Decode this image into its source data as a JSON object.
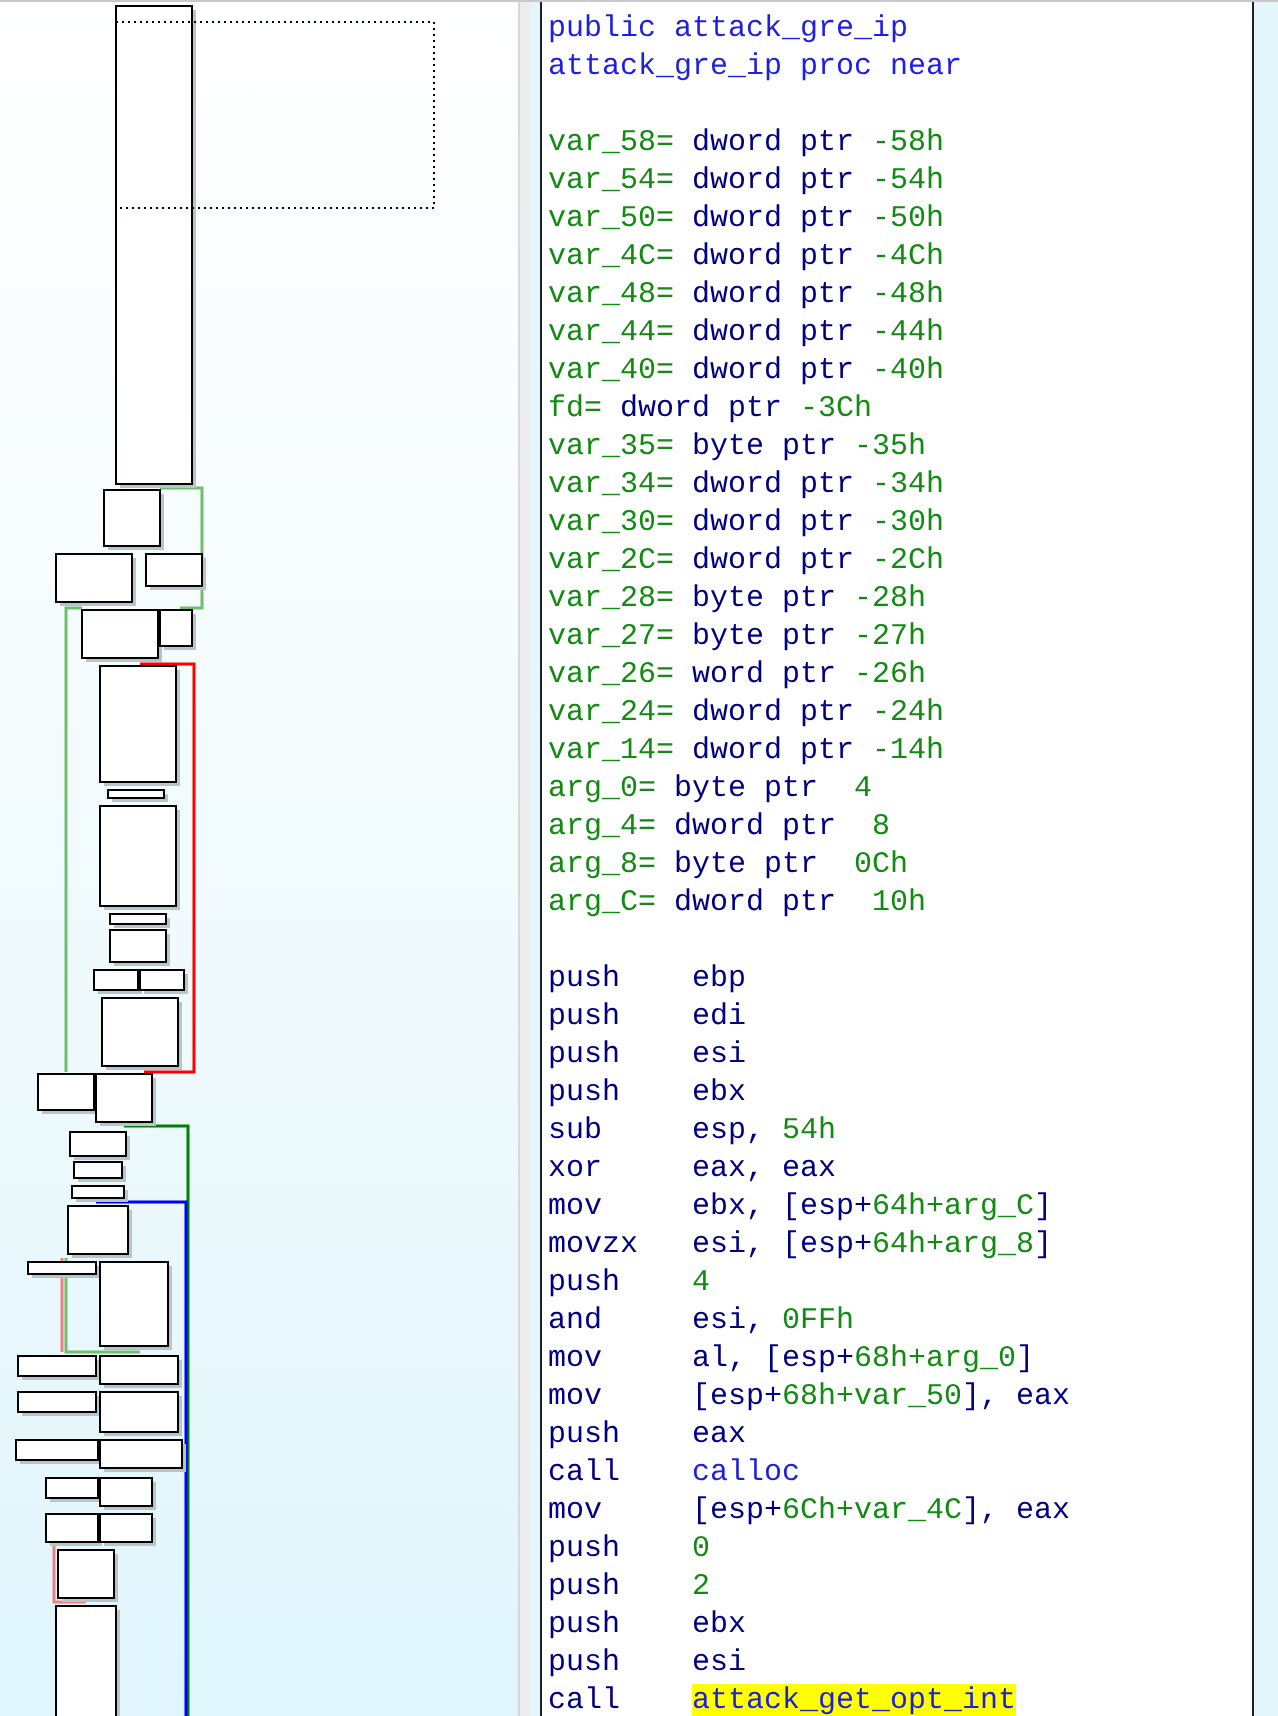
{
  "listing": [
    {
      "kind": "text",
      "tokens": [
        {
          "text": "public attack_gre_ip",
          "kind": "label"
        }
      ]
    },
    {
      "kind": "text",
      "tokens": [
        {
          "text": "attack_gre_ip proc near",
          "kind": "label"
        }
      ]
    },
    {
      "kind": "blank"
    },
    {
      "kind": "text",
      "tokens": [
        {
          "text": "var_58=",
          "kind": "value"
        },
        {
          "text": " dword ptr ",
          "kind": "keyword"
        },
        {
          "text": "-58h",
          "kind": "value"
        }
      ]
    },
    {
      "kind": "text",
      "tokens": [
        {
          "text": "var_54=",
          "kind": "value"
        },
        {
          "text": " dword ptr ",
          "kind": "keyword"
        },
        {
          "text": "-54h",
          "kind": "value"
        }
      ]
    },
    {
      "kind": "text",
      "tokens": [
        {
          "text": "var_50=",
          "kind": "value"
        },
        {
          "text": " dword ptr ",
          "kind": "keyword"
        },
        {
          "text": "-50h",
          "kind": "value"
        }
      ]
    },
    {
      "kind": "text",
      "tokens": [
        {
          "text": "var_4C=",
          "kind": "value"
        },
        {
          "text": " dword ptr ",
          "kind": "keyword"
        },
        {
          "text": "-4Ch",
          "kind": "value"
        }
      ]
    },
    {
      "kind": "text",
      "tokens": [
        {
          "text": "var_48=",
          "kind": "value"
        },
        {
          "text": " dword ptr ",
          "kind": "keyword"
        },
        {
          "text": "-48h",
          "kind": "value"
        }
      ]
    },
    {
      "kind": "text",
      "tokens": [
        {
          "text": "var_44=",
          "kind": "value"
        },
        {
          "text": " dword ptr ",
          "kind": "keyword"
        },
        {
          "text": "-44h",
          "kind": "value"
        }
      ]
    },
    {
      "kind": "text",
      "tokens": [
        {
          "text": "var_40=",
          "kind": "value"
        },
        {
          "text": " dword ptr ",
          "kind": "keyword"
        },
        {
          "text": "-40h",
          "kind": "value"
        }
      ]
    },
    {
      "kind": "text",
      "tokens": [
        {
          "text": "fd=",
          "kind": "value"
        },
        {
          "text": " dword ptr ",
          "kind": "keyword"
        },
        {
          "text": "-3Ch",
          "kind": "value"
        }
      ]
    },
    {
      "kind": "text",
      "tokens": [
        {
          "text": "var_35=",
          "kind": "value"
        },
        {
          "text": " byte ptr ",
          "kind": "keyword"
        },
        {
          "text": "-35h",
          "kind": "value"
        }
      ]
    },
    {
      "kind": "text",
      "tokens": [
        {
          "text": "var_34=",
          "kind": "value"
        },
        {
          "text": " dword ptr ",
          "kind": "keyword"
        },
        {
          "text": "-34h",
          "kind": "value"
        }
      ]
    },
    {
      "kind": "text",
      "tokens": [
        {
          "text": "var_30=",
          "kind": "value"
        },
        {
          "text": " dword ptr ",
          "kind": "keyword"
        },
        {
          "text": "-30h",
          "kind": "value"
        }
      ]
    },
    {
      "kind": "text",
      "tokens": [
        {
          "text": "var_2C=",
          "kind": "value"
        },
        {
          "text": " dword ptr ",
          "kind": "keyword"
        },
        {
          "text": "-2Ch",
          "kind": "value"
        }
      ]
    },
    {
      "kind": "text",
      "tokens": [
        {
          "text": "var_28=",
          "kind": "value"
        },
        {
          "text": " byte ptr ",
          "kind": "keyword"
        },
        {
          "text": "-28h",
          "kind": "value"
        }
      ]
    },
    {
      "kind": "text",
      "tokens": [
        {
          "text": "var_27=",
          "kind": "value"
        },
        {
          "text": " byte ptr ",
          "kind": "keyword"
        },
        {
          "text": "-27h",
          "kind": "value"
        }
      ]
    },
    {
      "kind": "text",
      "tokens": [
        {
          "text": "var_26=",
          "kind": "value"
        },
        {
          "text": " word ptr ",
          "kind": "keyword"
        },
        {
          "text": "-26h",
          "kind": "value"
        }
      ]
    },
    {
      "kind": "text",
      "tokens": [
        {
          "text": "var_24=",
          "kind": "value"
        },
        {
          "text": " dword ptr ",
          "kind": "keyword"
        },
        {
          "text": "-24h",
          "kind": "value"
        }
      ]
    },
    {
      "kind": "text",
      "tokens": [
        {
          "text": "var_14=",
          "kind": "value"
        },
        {
          "text": " dword ptr ",
          "kind": "keyword"
        },
        {
          "text": "-14h",
          "kind": "value"
        }
      ]
    },
    {
      "kind": "text",
      "tokens": [
        {
          "text": "arg_0=",
          "kind": "value"
        },
        {
          "text": " byte ptr  ",
          "kind": "keyword"
        },
        {
          "text": "4",
          "kind": "value"
        }
      ]
    },
    {
      "kind": "text",
      "tokens": [
        {
          "text": "arg_4=",
          "kind": "value"
        },
        {
          "text": " dword ptr  ",
          "kind": "keyword"
        },
        {
          "text": "8",
          "kind": "value"
        }
      ]
    },
    {
      "kind": "text",
      "tokens": [
        {
          "text": "arg_8=",
          "kind": "value"
        },
        {
          "text": " byte ptr  ",
          "kind": "keyword"
        },
        {
          "text": "0Ch",
          "kind": "value"
        }
      ]
    },
    {
      "kind": "text",
      "tokens": [
        {
          "text": "arg_C=",
          "kind": "value"
        },
        {
          "text": " dword ptr  ",
          "kind": "keyword"
        },
        {
          "text": "10h",
          "kind": "value"
        }
      ]
    },
    {
      "kind": "blank"
    },
    {
      "kind": "instr",
      "mnemonic": "push",
      "tokens": [
        {
          "text": "ebp",
          "kind": "keyword"
        }
      ]
    },
    {
      "kind": "instr",
      "mnemonic": "push",
      "tokens": [
        {
          "text": "edi",
          "kind": "keyword"
        }
      ]
    },
    {
      "kind": "instr",
      "mnemonic": "push",
      "tokens": [
        {
          "text": "esi",
          "kind": "keyword"
        }
      ]
    },
    {
      "kind": "instr",
      "mnemonic": "push",
      "tokens": [
        {
          "text": "ebx",
          "kind": "keyword"
        }
      ]
    },
    {
      "kind": "instr",
      "mnemonic": "sub",
      "tokens": [
        {
          "text": "esp, ",
          "kind": "keyword"
        },
        {
          "text": "54h",
          "kind": "value"
        }
      ]
    },
    {
      "kind": "instr",
      "mnemonic": "xor",
      "tokens": [
        {
          "text": "eax, eax",
          "kind": "keyword"
        }
      ]
    },
    {
      "kind": "instr",
      "mnemonic": "mov",
      "tokens": [
        {
          "text": "ebx, [esp+",
          "kind": "keyword"
        },
        {
          "text": "64h+arg_C",
          "kind": "value"
        },
        {
          "text": "]",
          "kind": "keyword"
        }
      ]
    },
    {
      "kind": "instr",
      "mnemonic": "movzx",
      "tokens": [
        {
          "text": "esi, [esp+",
          "kind": "keyword"
        },
        {
          "text": "64h+arg_8",
          "kind": "value"
        },
        {
          "text": "]",
          "kind": "keyword"
        }
      ]
    },
    {
      "kind": "instr",
      "mnemonic": "push",
      "tokens": [
        {
          "text": "4",
          "kind": "value"
        }
      ]
    },
    {
      "kind": "instr",
      "mnemonic": "and",
      "tokens": [
        {
          "text": "esi, ",
          "kind": "keyword"
        },
        {
          "text": "0FFh",
          "kind": "value"
        }
      ]
    },
    {
      "kind": "instr",
      "mnemonic": "mov",
      "tokens": [
        {
          "text": "al, [esp+",
          "kind": "keyword"
        },
        {
          "text": "68h+arg_0",
          "kind": "value"
        },
        {
          "text": "]",
          "kind": "keyword"
        }
      ]
    },
    {
      "kind": "instr",
      "mnemonic": "mov",
      "tokens": [
        {
          "text": "[esp+",
          "kind": "keyword"
        },
        {
          "text": "68h+var_50",
          "kind": "value"
        },
        {
          "text": "], eax",
          "kind": "keyword"
        }
      ]
    },
    {
      "kind": "instr",
      "mnemonic": "push",
      "tokens": [
        {
          "text": "eax",
          "kind": "keyword"
        }
      ]
    },
    {
      "kind": "instr",
      "mnemonic": "call",
      "tokens": [
        {
          "text": "calloc",
          "kind": "label"
        }
      ]
    },
    {
      "kind": "instr",
      "mnemonic": "mov",
      "tokens": [
        {
          "text": "[esp+",
          "kind": "keyword"
        },
        {
          "text": "6Ch+var_4C",
          "kind": "value"
        },
        {
          "text": "], eax",
          "kind": "keyword"
        }
      ]
    },
    {
      "kind": "instr",
      "mnemonic": "push",
      "tokens": [
        {
          "text": "0",
          "kind": "value"
        }
      ]
    },
    {
      "kind": "instr",
      "mnemonic": "push",
      "tokens": [
        {
          "text": "2",
          "kind": "value"
        }
      ]
    },
    {
      "kind": "instr",
      "mnemonic": "push",
      "tokens": [
        {
          "text": "ebx",
          "kind": "keyword"
        }
      ]
    },
    {
      "kind": "instr",
      "mnemonic": "push",
      "tokens": [
        {
          "text": "esi",
          "kind": "keyword"
        }
      ]
    },
    {
      "kind": "instr",
      "mnemonic": "call",
      "tokens": [
        {
          "text": "attack_get_opt_int",
          "kind": "highlight"
        }
      ]
    }
  ]
}
